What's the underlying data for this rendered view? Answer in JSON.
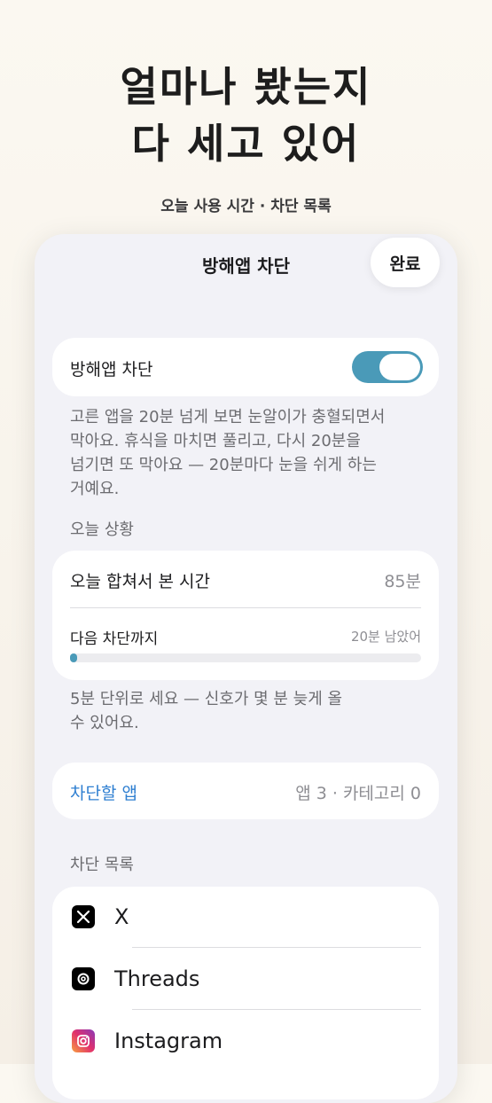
{
  "hero": {
    "title_line1": "얼마나 봤는지",
    "title_line2": "다 세고 있어",
    "subtitle": "오늘 사용 시간 · 차단 목록"
  },
  "nav": {
    "title": "방해앱 차단",
    "done_label": "완료"
  },
  "blocker": {
    "label": "방해앱 차단",
    "enabled": true,
    "description_lines": [
      "고른 앱을 20분 넘게 보면 눈알이가 충혈되면서",
      "막아요. 휴식을 마치면 풀리고, 다시 20분을",
      "넘기면 또 막아요 — 20분마다 눈을 쉬게 하는",
      "거예요."
    ]
  },
  "today": {
    "section_title": "오늘 상황",
    "total_label": "오늘 합쳐서 본 시간",
    "total_value": "85분",
    "next_label": "다음 차단까지",
    "next_value": "20분 남았어",
    "progress_fraction": 0.02,
    "note_lines": [
      "5분 단위로 세요 — 신호가 몇 분 늦게 올",
      "수 있어요."
    ]
  },
  "apps_to_block": {
    "label": "차단할 앱",
    "summary": "앱 3 · 카테고리 0"
  },
  "block_list": {
    "section_title": "차단 목록",
    "apps": [
      {
        "name": "X",
        "icon": "x-logo-icon",
        "color": "#000000"
      },
      {
        "name": "Threads",
        "icon": "threads-logo-icon",
        "color": "#000000"
      },
      {
        "name": "Instagram",
        "icon": "instagram-logo-icon",
        "color": "#e1306c"
      }
    ]
  },
  "colors": {
    "accent": "#4a9ab8",
    "link": "#2f7fd1"
  }
}
